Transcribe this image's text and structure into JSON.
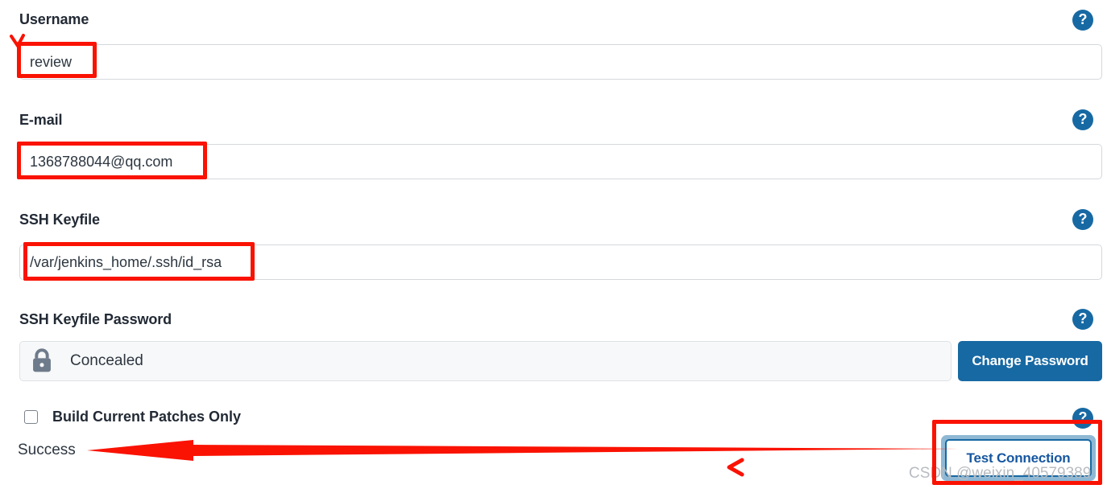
{
  "form": {
    "fields": [
      {
        "label": "Username",
        "value": "review",
        "help_icon": "question-mark-icon"
      },
      {
        "label": "E-mail",
        "value": "1368788044@qq.com",
        "help_icon": "question-mark-icon"
      },
      {
        "label": "SSH Keyfile",
        "value": "/var/jenkins_home/.ssh/id_rsa",
        "help_icon": "question-mark-icon"
      },
      {
        "label": "SSH Keyfile Password",
        "value": "Concealed",
        "help_icon": "question-mark-icon"
      }
    ],
    "password_row": {
      "lock_icon": "padlock-icon",
      "concealed_value": "Concealed",
      "change_password_label": "Change Password"
    },
    "checkbox_row": {
      "label": "Build Current Patches Only",
      "checked": false,
      "help_icon": "question-mark-icon"
    },
    "status": {
      "text": "Success"
    },
    "test_connection": {
      "label": "Test Connection"
    }
  },
  "help_icon_glyph": "?",
  "watermark": {
    "text": "CSDN @weixin_40579389"
  },
  "colors": {
    "accent_blue": "#1769a3",
    "annotation_red": "#fa1202",
    "label_text": "#222a35",
    "input_border": "#d5d8dc",
    "focus_ring": "#8fb8d4",
    "lock_gray": "#6e7b8b",
    "watermark_gray": "#b9bcc0"
  }
}
